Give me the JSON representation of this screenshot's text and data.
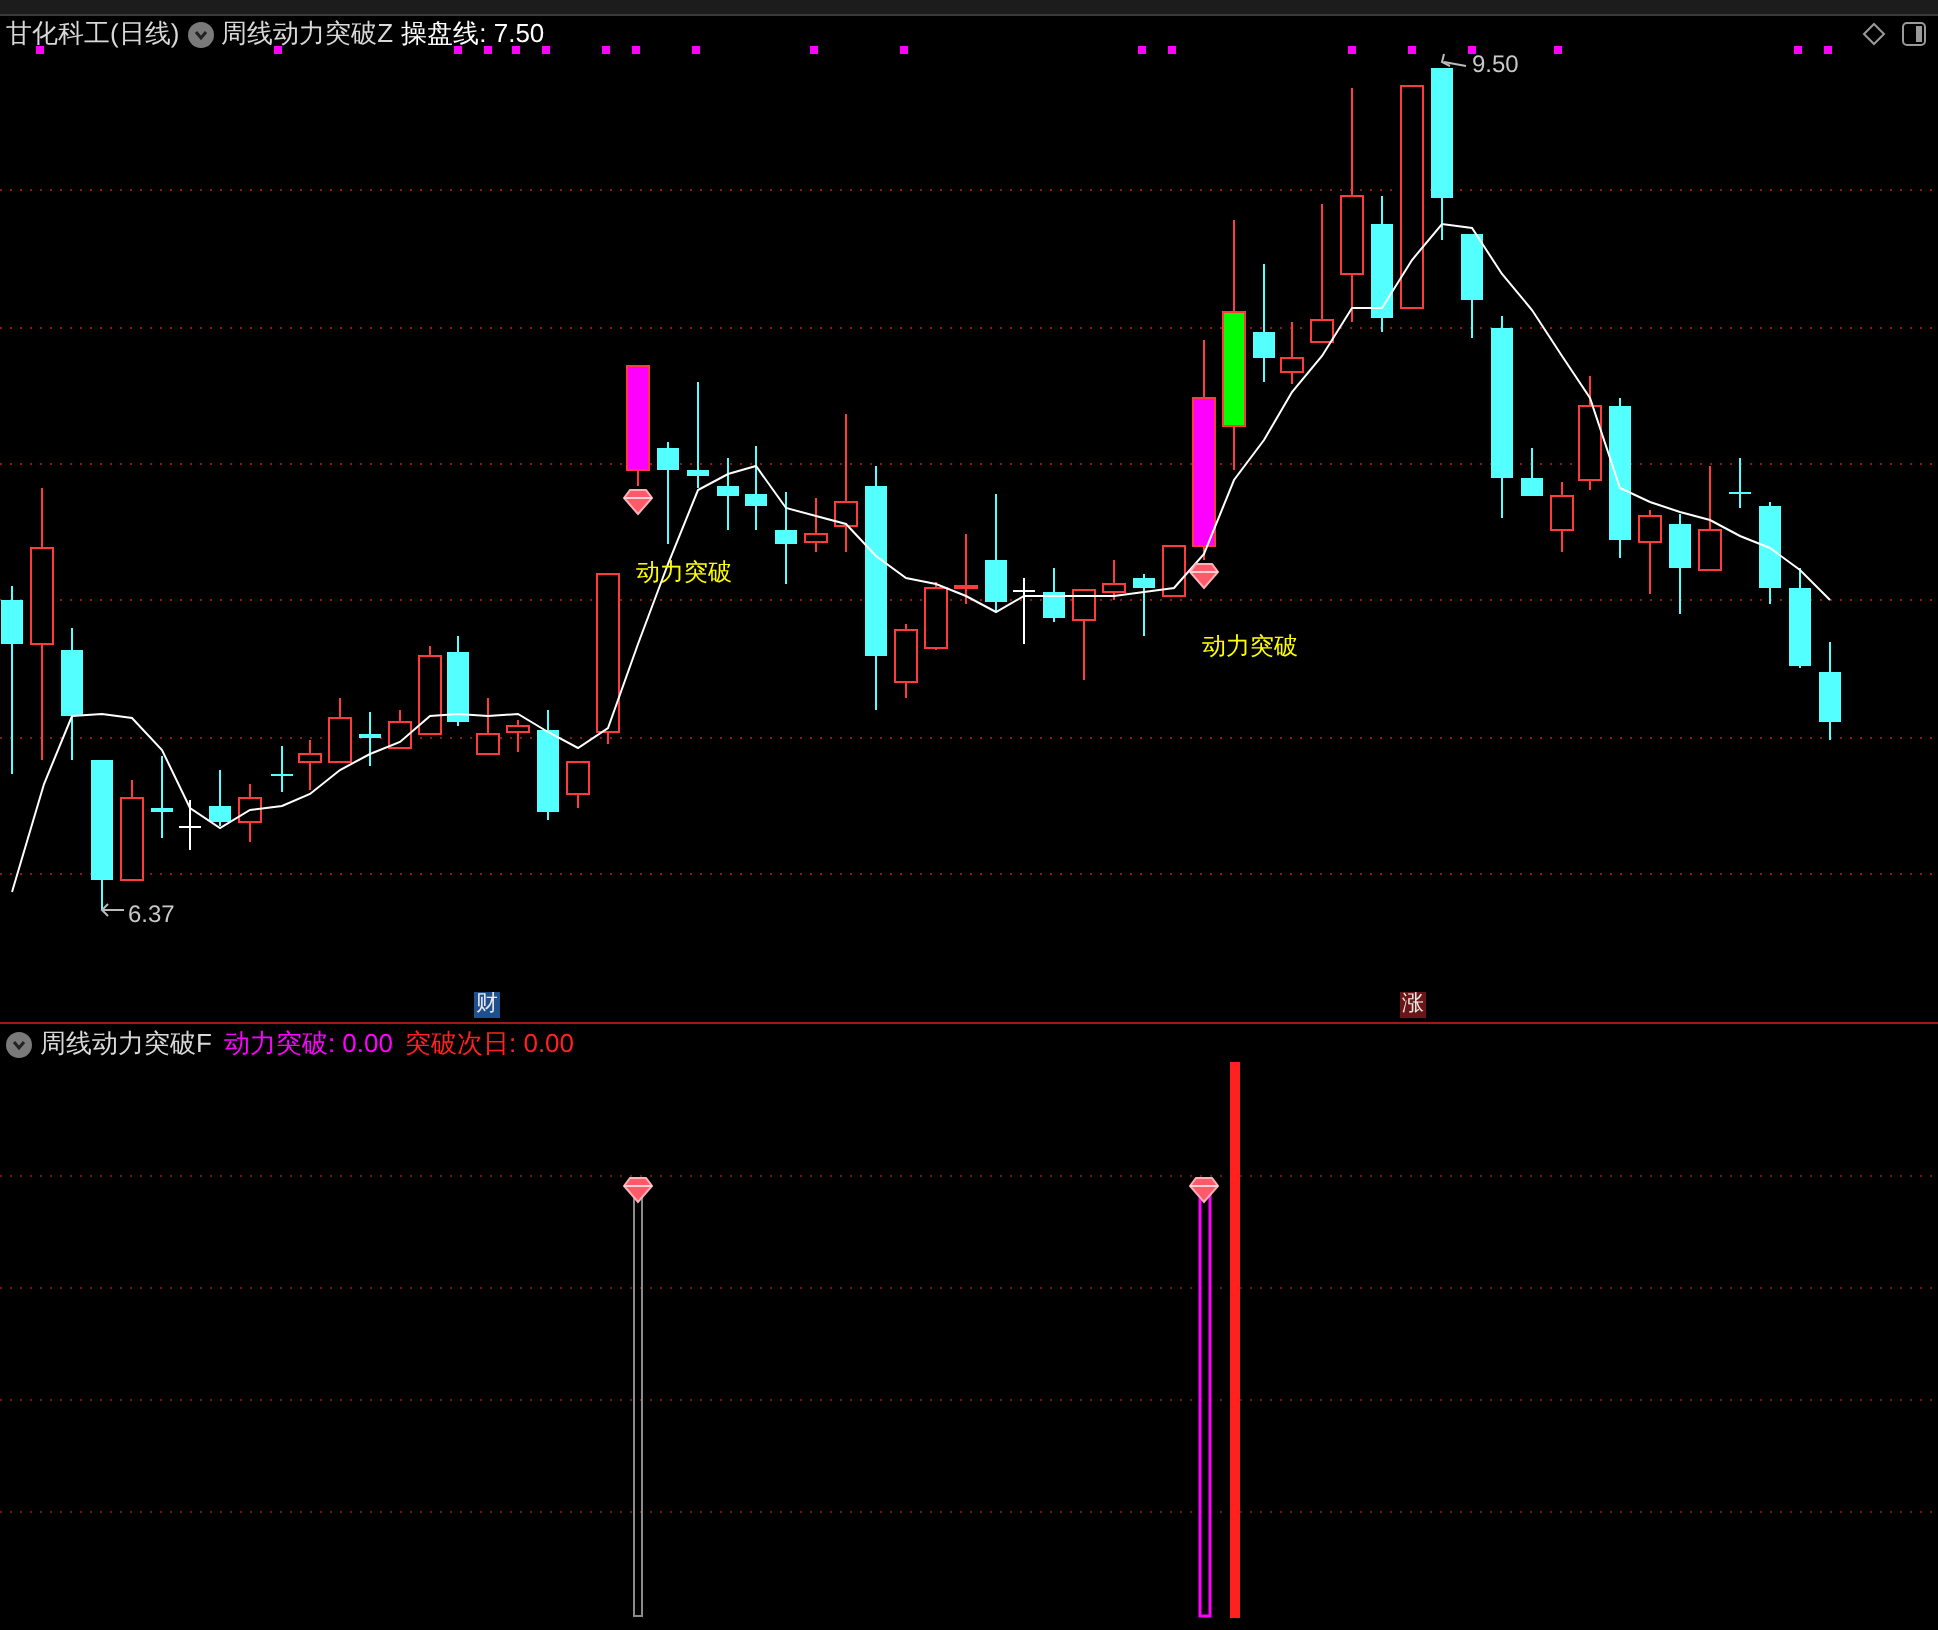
{
  "chart": {
    "stock_title": "甘化科工(日线)",
    "indicator_name": "周线动力突破Z",
    "indicator_value": "操盘线: 7.50",
    "high_label": "9.50",
    "low_label": "6.37",
    "signals": [
      {
        "label": "动力突破"
      },
      {
        "label": "动力突破"
      }
    ],
    "event_tags": [
      {
        "label": "财",
        "color": "#1e4f8f"
      },
      {
        "label": "涨",
        "color": "#6a1616"
      }
    ]
  },
  "sub_chart": {
    "indicator_name": "周线动力突破F",
    "values": [
      {
        "label": "动力突破: 0.00",
        "color": "#ff00ff"
      },
      {
        "label": "突破次日: 0.00",
        "color": "#ff2020"
      }
    ]
  }
}
